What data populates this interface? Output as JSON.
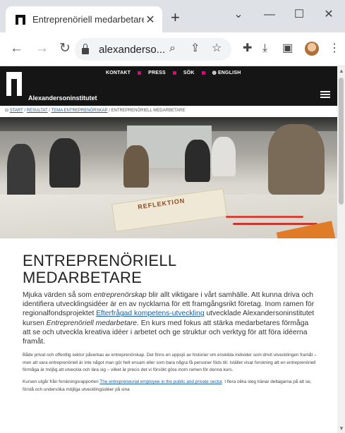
{
  "browser": {
    "tab_title": "Entreprenöriell medarbetare",
    "tab_close": "✕",
    "new_tab": "+",
    "window_controls": {
      "minimize": "—",
      "maximize": "☐",
      "close": "✕",
      "expand": "⌄"
    },
    "url": "alexanderso...",
    "icons": [
      "back-icon",
      "forward-icon",
      "reload-icon",
      "lock-icon",
      "zoom-icon",
      "share-icon",
      "bookmark-star-icon",
      "extensions-icon",
      "download-icon",
      "sidepanel-icon",
      "profile-avatar",
      "menu-icon"
    ]
  },
  "site": {
    "nav": [
      "KONTAKT",
      "PRESS",
      "SÖK",
      "ENGLISH"
    ],
    "logo_text": "Alexandersoninstitutet",
    "accent_color": "#e6007e",
    "breadcrumb": {
      "prefix": "⊟ ",
      "items": [
        "START",
        "RESULTAT",
        "TEMA ENTREPRENÖRSKAP"
      ],
      "current": "ENTREPRENÖRIELL MEDARBETARE",
      "separator": " / "
    },
    "hero_card_text": "REFLEKTION"
  },
  "article": {
    "title_line1": "ENTREPRENÖRIELL",
    "title_line2": "MEDARBETARE",
    "lead_a": "Mjuka värden så som ",
    "lead_em1": "entreprenörskap",
    "lead_b": " blir allt viktigare i vårt samhälle. Att kunna driva och identifiera utvecklingsidéer är en av nycklarna för ett framgångsrikt företag. Inom ramen för regionalfondsprojektet ",
    "lead_link": "Efterfrågad kompetens-utveckling",
    "lead_c": " utvecklade Alexandersoninstitutet kursen ",
    "lead_em2": "Entreprenöriell medarbetare",
    "lead_d": ". En kurs med fokus att stärka medarbetares förmåga att se och utveckla kreativa idéer i arbetet och ge struktur och verktyg för att föra idéerna framåt.",
    "para1": "Både privat och offentlig sektor påverkas av entreprenörskap. Det finns en uppsjö av historier om enskilda individer som drivit utvecklingen framåt – men att vara entreprenöriell är inte något man gör helt ensam eller som bara några få personer föds till. Istället visar forskning att en entreprenöriell förmåga är möjlig att utveckla och lära sig – vilket är precis det vi försökt göra inom ramen för denna kurs.",
    "para2_a": "Kursen utgår från forskningsrapporten ",
    "para2_link": "The entrepreneurial employee in the public and private sector",
    "para2_b": ". I flera olika steg tränar deltagarna på att se, förstå och undersöka möjliga utvecklingsidéer på sina"
  }
}
